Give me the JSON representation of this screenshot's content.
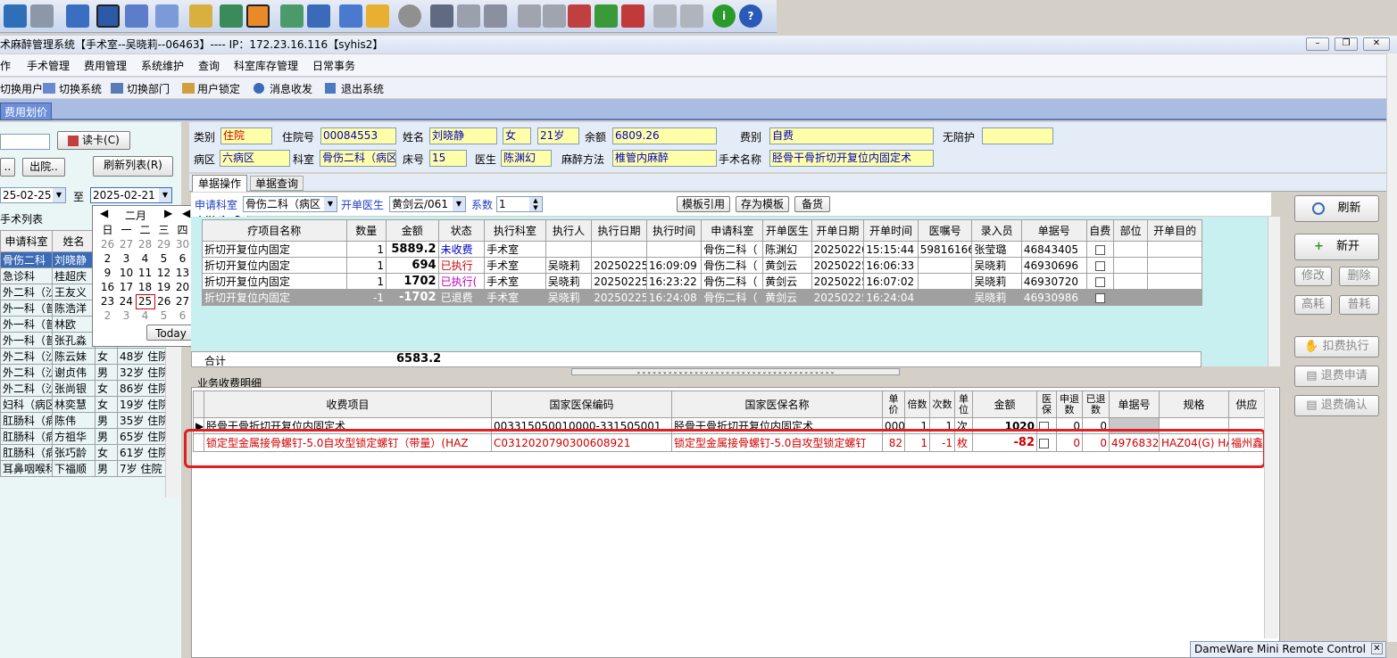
{
  "window_title": "术麻醉管理系统【手术室--吴晓莉--06463】---- IP：172.23.16.116【syhis2】",
  "menu": [
    "作",
    "手术管理",
    "费用管理",
    "系统维护",
    "查询",
    "科室库存管理",
    "日常事务"
  ],
  "quickbar": [
    "切换用户",
    "切换系统",
    "切换部门",
    "用户锁定",
    "消息收发",
    "退出系统"
  ],
  "active_tab": "费用划价",
  "left": {
    "read_card": "读卡(C)",
    "btn_dots": "..",
    "btn_discharge": "出院..",
    "btn_refresh": "刷新列表(R)",
    "date_from": "25-02-25",
    "to_label": "至",
    "date_to": "2025-02-21",
    "list_title": "手术列表",
    "headers": [
      "申请科室",
      "姓名"
    ],
    "rows": [
      [
        "骨伤二科",
        "刘晓静",
        "",
        ""
      ],
      [
        "急诊科",
        "桂超庆",
        "",
        ""
      ],
      [
        "外二科（沙",
        "王友义",
        "",
        ""
      ],
      [
        "外一科（普",
        "陈浩洋",
        "",
        ""
      ],
      [
        "外一科（普",
        "林欧",
        "",
        ""
      ],
      [
        "外一科（普",
        "张孔淼",
        "",
        ""
      ],
      [
        "外二科（沙",
        "陈云妹",
        "女",
        "48岁 住院"
      ],
      [
        "外二科（沙",
        "谢贞伟",
        "男",
        "32岁 住院"
      ],
      [
        "外二科（沙",
        "张尚银",
        "女",
        "86岁 住院"
      ],
      [
        "妇科（病区",
        "林奕慧",
        "女",
        "19岁 住院"
      ],
      [
        "肛肠科（病",
        "陈伟",
        "男",
        "35岁 住院"
      ],
      [
        "肛肠科（病",
        "方祖华",
        "男",
        "65岁 住院"
      ],
      [
        "肛肠科（病",
        "张巧龄",
        "女",
        "61岁 住院"
      ],
      [
        "耳鼻咽喉科",
        "下福顺",
        "男",
        "7岁 住院"
      ]
    ]
  },
  "calendar": {
    "month": "二月",
    "year": "2025",
    "weekdays": [
      "日",
      "一",
      "二",
      "三",
      "四",
      "五",
      "六"
    ],
    "weeks": [
      [
        "26",
        "27",
        "28",
        "29",
        "30",
        "31",
        "1"
      ],
      [
        "2",
        "3",
        "4",
        "5",
        "6",
        "7",
        "8"
      ],
      [
        "9",
        "10",
        "11",
        "12",
        "13",
        "14",
        "15"
      ],
      [
        "16",
        "17",
        "18",
        "19",
        "20",
        "21",
        "22"
      ],
      [
        "23",
        "24",
        "25",
        "26",
        "27",
        "28",
        "1"
      ],
      [
        "2",
        "3",
        "4",
        "5",
        "6",
        "7",
        "8"
      ]
    ],
    "today": "Today"
  },
  "patient": {
    "category_label": "类别",
    "category": "住院",
    "inpatient_no_label": "住院号",
    "inpatient_no": "00084553",
    "name_label": "姓名",
    "name": "刘晓静",
    "sex": "女",
    "age": "21岁",
    "balance_label": "余额",
    "balance": "6809.26",
    "fee_type_label": "费别",
    "fee_type": "自费",
    "escort_label": "无陪护",
    "escort": "",
    "ward_label": "病区",
    "ward": "六病区",
    "dept_label": "科室",
    "dept": "骨伤二科（病区",
    "bed_label": "床号",
    "bed": "15",
    "doctor_label": "医生",
    "doctor": "陈渊幻",
    "anesthesia_label": "麻醉方法",
    "anesthesia": "椎管内麻醉",
    "surgery_label": "手术名称",
    "surgery": "胫骨干骨折切开复位内固定术"
  },
  "subtabs": [
    "单据操作",
    "单据查询"
  ],
  "order_bar": {
    "apply_dept_label": "申请科室",
    "apply_dept": "骨伤二科（病区",
    "doctor_label": "开单医生",
    "doctor": "黄剑云/061",
    "coef_label": "系数",
    "coef": "1",
    "btn_template_ref": "模板引用",
    "btn_save_template": "存为模板",
    "btn_stock": "备货"
  },
  "orders": {
    "headers": [
      "疗项目名称",
      "数量",
      "金额",
      "状态",
      "执行科室",
      "执行人",
      "执行日期",
      "执行时间",
      "申请科室",
      "开单医生",
      "开单日期",
      "开单时间",
      "医嘱号",
      "录入员",
      "单据号",
      "自费",
      "部位",
      "开单目的"
    ],
    "rows": [
      {
        "name": "折切开复位内固定",
        "qty": "1",
        "amount": "5889.2",
        "status": "未收费",
        "exec_dept": "手术室",
        "executor": "",
        "exec_date": "",
        "exec_time": "",
        "apply_dept": "骨伤二科（",
        "doctor": "陈渊幻",
        "order_date": "20250220",
        "order_time": "15:15:44",
        "advice_no": "59816166",
        "clerk": "张莹璐",
        "doc_no": "46843405"
      },
      {
        "name": "折切开复位内固定",
        "qty": "1",
        "amount": "694",
        "status": "已执行",
        "exec_dept": "手术室",
        "executor": "吴晓莉",
        "exec_date": "20250225",
        "exec_time": "16:09:09",
        "apply_dept": "骨伤二科（",
        "doctor": "黄剑云",
        "order_date": "20250225",
        "order_time": "16:06:33",
        "advice_no": "",
        "clerk": "吴晓莉",
        "doc_no": "46930696"
      },
      {
        "name": "折切开复位内固定",
        "qty": "1",
        "amount": "1702",
        "status": "已执行(",
        "exec_dept": "手术室",
        "executor": "吴晓莉",
        "exec_date": "20250225",
        "exec_time": "16:23:22",
        "apply_dept": "骨伤二科（",
        "doctor": "黄剑云",
        "order_date": "20250225",
        "order_time": "16:07:02",
        "advice_no": "",
        "clerk": "吴晓莉",
        "doc_no": "46930720"
      },
      {
        "name": "折切开复位内固定",
        "qty": "-1",
        "amount": "-1702",
        "status": "已退费",
        "exec_dept": "手术室",
        "executor": "吴晓莉",
        "exec_date": "20250225",
        "exec_time": "16:24:08",
        "apply_dept": "骨伤二科（",
        "doctor": "黄剑云",
        "order_date": "20250225",
        "order_time": "16:24:04",
        "advice_no": "",
        "clerk": "吴晓莉",
        "doc_no": "46930986"
      }
    ],
    "total_label": "合计",
    "total": "6583.2"
  },
  "detail": {
    "title": "业务收费明细",
    "headers": [
      "收费项目",
      "国家医保编码",
      "国家医保名称",
      "单价",
      "倍数",
      "次数",
      "单位",
      "金额",
      "医保",
      "申退数",
      "已退数",
      "单据号",
      "规格",
      "供应"
    ],
    "row1": {
      "item": "胫骨干骨折切开复位内固定术",
      "code": "003315050010000-331505001",
      "name": "胫骨干骨折切开复位内固定术",
      "price": "000",
      "mult": "1",
      "times": "1",
      "unit": "次",
      "amount": "1020",
      "r": "0",
      "d": "0"
    },
    "row2": {
      "item": "锁定型金属接骨螺钉-5.0自攻型锁定螺钉（带量）(HAZ",
      "code": "C0312020790300608921",
      "name": "锁定型金属接骨螺钉-5.0自攻型锁定螺钉",
      "price": "82",
      "mult": "1",
      "times": "-1",
      "unit": "枚",
      "amount": "-82",
      "r": "0",
      "d": "0",
      "doc": "49768329",
      "spec": "HAZ04(G) HA",
      "supplier": "福州鑫"
    }
  },
  "right_buttons": {
    "refresh": "刷新",
    "new": "新开",
    "modify": "修改",
    "delete": "删除",
    "high": "高耗",
    "normal": "普耗",
    "deduct": "扣费执行",
    "refund_apply": "退费申请",
    "refund_confirm": "退费确认"
  },
  "dameware": "DameWare Mini Remote Control"
}
